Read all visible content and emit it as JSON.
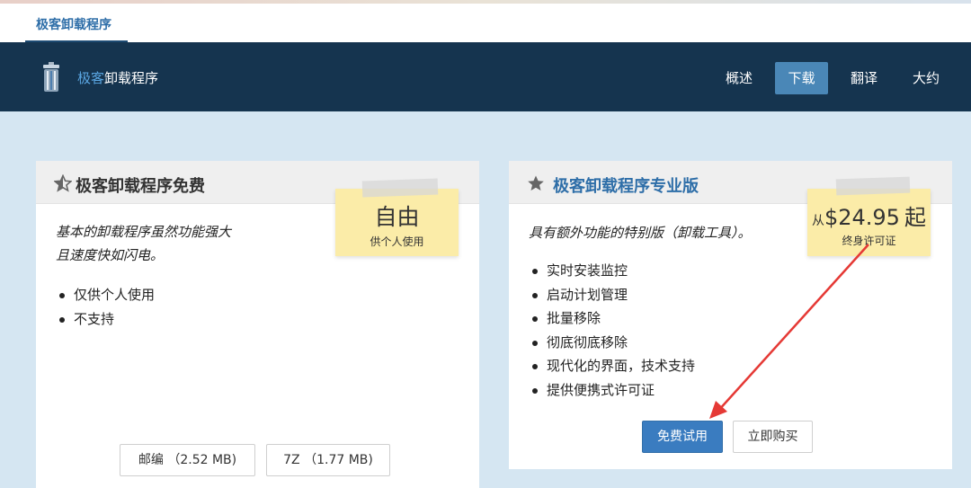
{
  "browser_tab": {
    "title": "极客卸载程序"
  },
  "navbar": {
    "brand_highlight": "极客",
    "brand_rest": "卸载程序",
    "items": [
      {
        "label": "概述",
        "active": false
      },
      {
        "label": "下载",
        "active": true
      },
      {
        "label": "翻译",
        "active": false
      },
      {
        "label": "大约",
        "active": false
      }
    ]
  },
  "free_card": {
    "title": "极客卸载程序免费",
    "price_big": "自由",
    "price_sub": "供个人使用",
    "desc_line1": "基本的卸载程序虽然功能强大",
    "desc_line2": "且速度快如闪电。",
    "features": [
      "仅供个人使用",
      "不支持"
    ],
    "download_zip": "邮编 （2.52 MB)",
    "download_7z": "7Z （1.77 MB)"
  },
  "pro_card": {
    "title": "极客卸载程序专业版",
    "price_prefix": "从",
    "price_value": "$24.95",
    "price_suffix": "起",
    "price_sub": "终身许可证",
    "desc": "具有额外功能的特别版（卸载工具）。",
    "features": [
      "实时安装监控",
      "启动计划管理",
      "批量移除",
      "彻底彻底移除",
      "现代化的界面，技术支持",
      "提供便携式许可证"
    ],
    "trial_button": "免费试用",
    "buy_button": "立即购买"
  },
  "colors": {
    "nav_bg": "#15344f",
    "accent": "#3a7cc0",
    "page_bg": "#d5e6f2",
    "sticky": "#fbeca8",
    "arrow": "#e53935"
  }
}
